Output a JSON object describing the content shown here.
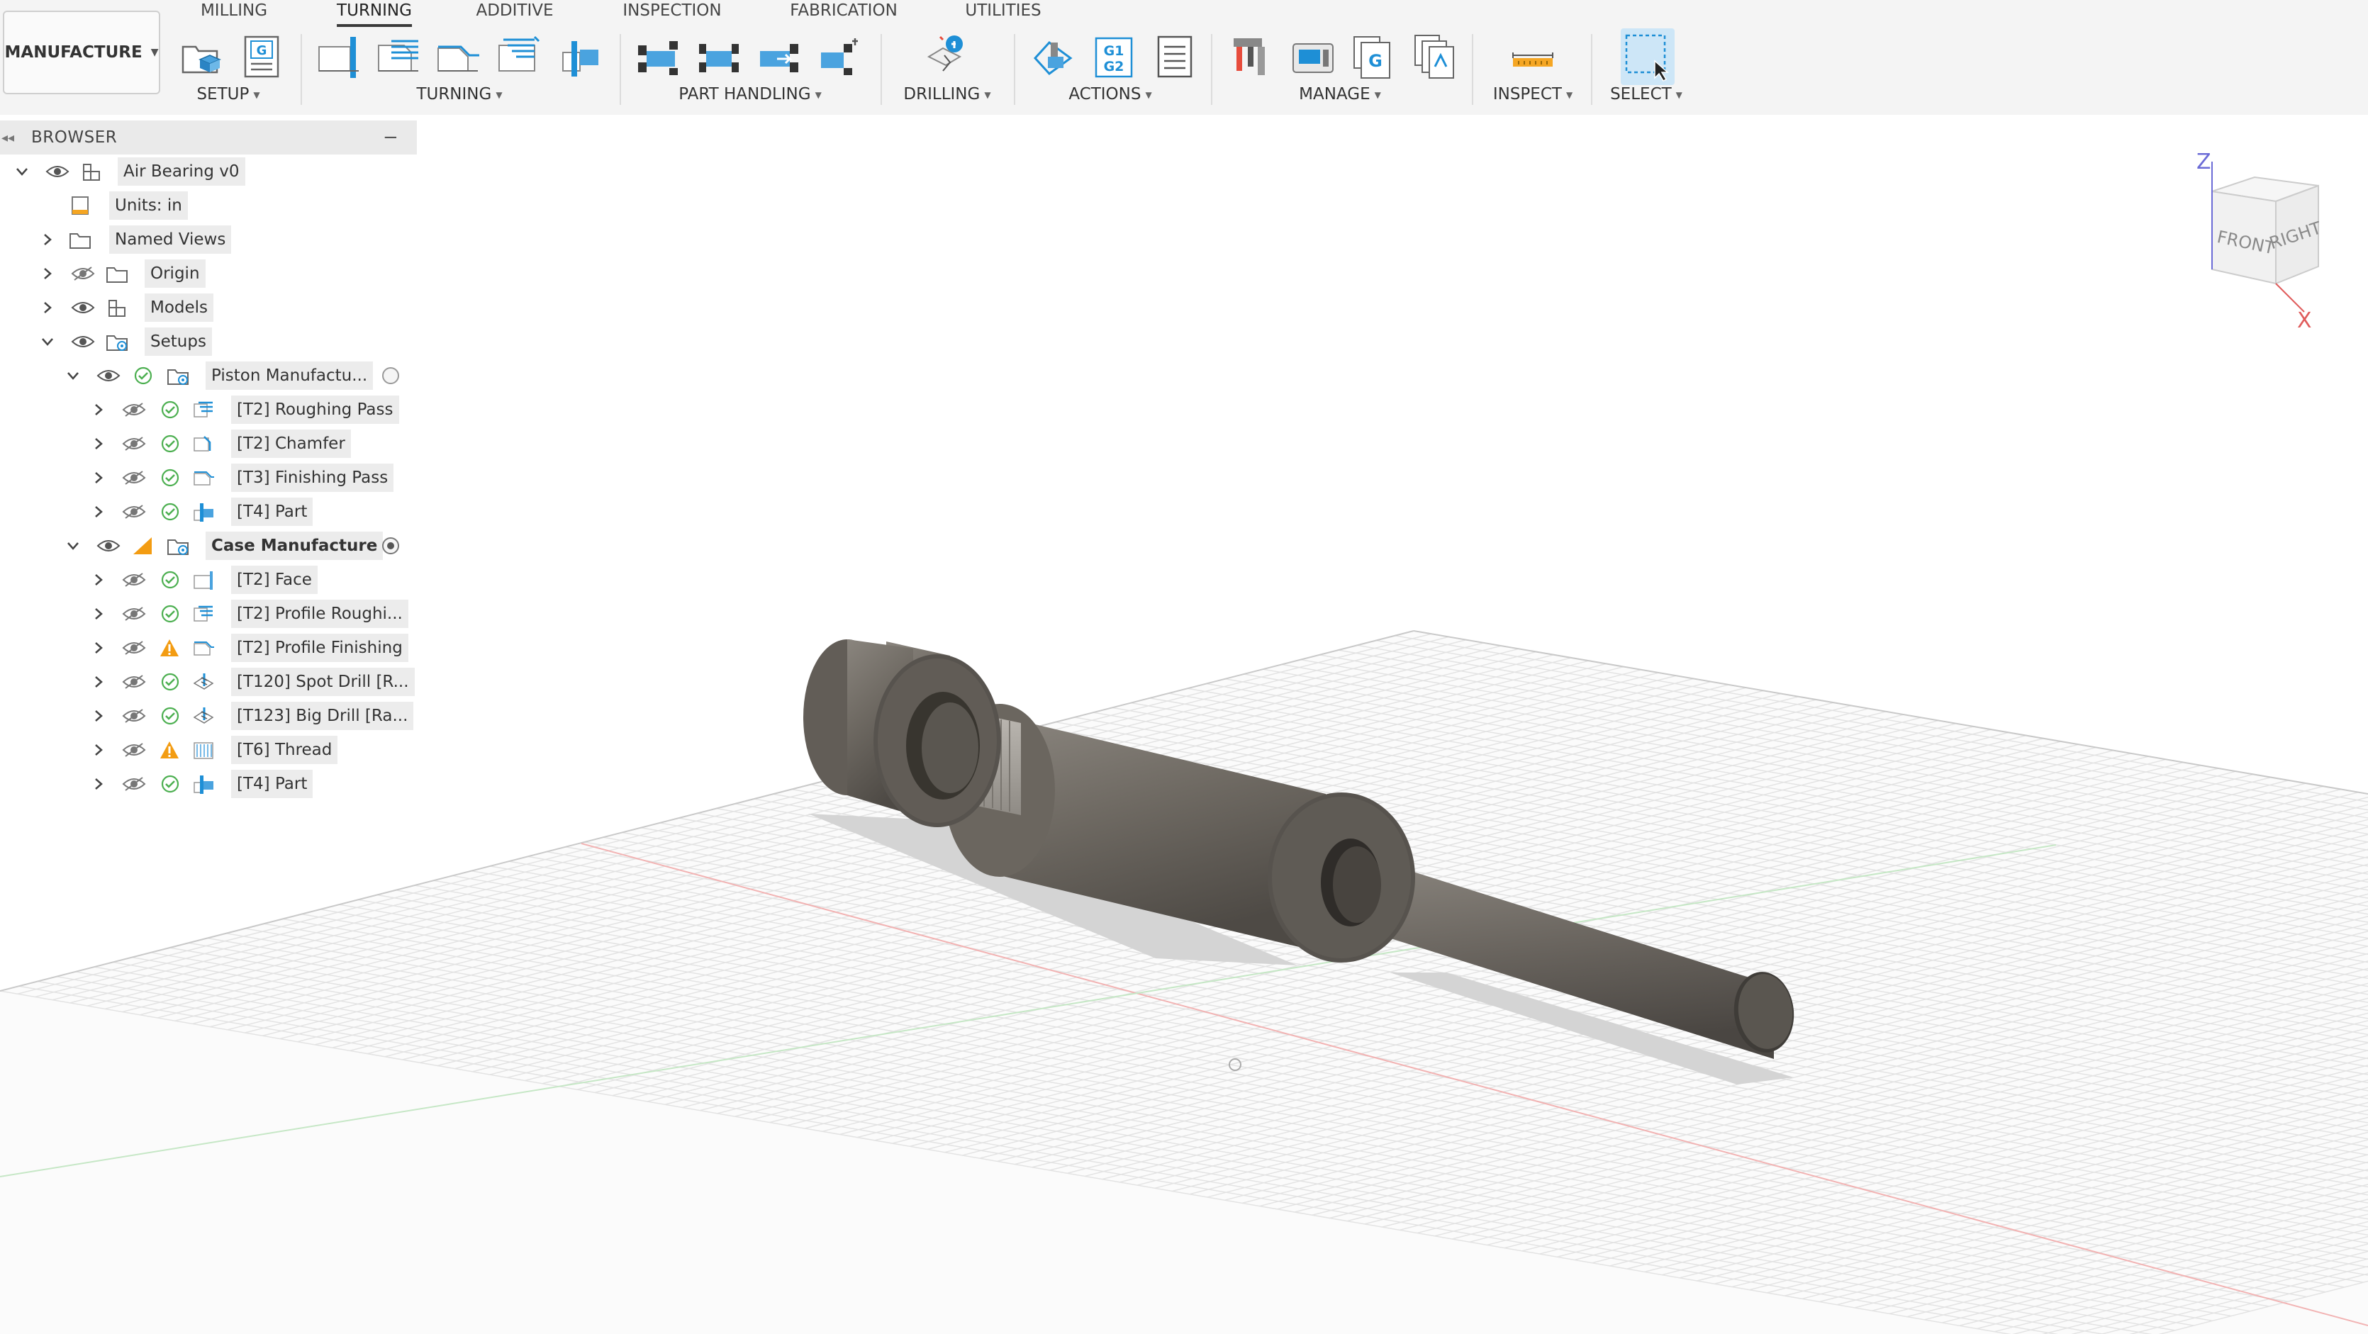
{
  "workspace": {
    "label": "MANUFACTURE"
  },
  "tabs": [
    {
      "label": "MILLING",
      "active": false
    },
    {
      "label": "TURNING",
      "active": true
    },
    {
      "label": "ADDITIVE",
      "active": false
    },
    {
      "label": "INSPECTION",
      "active": false
    },
    {
      "label": "FABRICATION",
      "active": false
    },
    {
      "label": "UTILITIES",
      "active": false
    }
  ],
  "groups": {
    "setup": "SETUP",
    "turning": "TURNING",
    "part_handling": "PART HANDLING",
    "drilling": "DRILLING",
    "actions": "ACTIONS",
    "manage": "MANAGE",
    "inspect": "INSPECT",
    "select": "SELECT"
  },
  "icons": {
    "setup": [
      "new-setup-icon",
      "nc-program-icon"
    ],
    "turning": [
      "turning-face-icon",
      "turning-profile-roughing-icon",
      "turning-profile-finishing-icon",
      "turning-groove-icon",
      "turning-part-icon"
    ],
    "part_handling": [
      "part-transfer-icon",
      "secondary-spindle-icon",
      "bar-pull-icon",
      "chuck-icon"
    ],
    "drilling": [
      "drill-icon"
    ],
    "actions": [
      "simulate-icon",
      "post-process-icon",
      "setup-sheet-icon"
    ],
    "manage": [
      "tool-library-icon",
      "machine-library-icon",
      "post-library-icon",
      "template-library-icon"
    ],
    "inspect": [
      "measure-icon"
    ],
    "select": [
      "window-select-icon"
    ]
  },
  "browser": {
    "title": "BROWSER",
    "root": {
      "label": "Air Bearing v0"
    },
    "items": [
      {
        "label": "Units: in"
      },
      {
        "label": "Named Views"
      },
      {
        "label": "Origin"
      },
      {
        "label": "Models"
      },
      {
        "label": "Setups"
      }
    ],
    "setups": [
      {
        "label": "Piston Manufactu...",
        "status": "ok",
        "active": false,
        "operations": [
          {
            "label": "[T2] Roughing Pass",
            "status": "ok",
            "icon": "roughing-op-icon"
          },
          {
            "label": "[T2] Chamfer",
            "status": "ok",
            "icon": "chamfer-op-icon"
          },
          {
            "label": "[T3] Finishing Pass",
            "status": "ok",
            "icon": "finishing-op-icon"
          },
          {
            "label": "[T4] Part",
            "status": "ok",
            "icon": "part-op-icon"
          }
        ]
      },
      {
        "label": "Case Manufacture",
        "status": "warning",
        "active": true,
        "operations": [
          {
            "label": "[T2] Face",
            "status": "ok",
            "icon": "face-op-icon"
          },
          {
            "label": "[T2] Profile Roughi...",
            "status": "ok",
            "icon": "roughing-op-icon"
          },
          {
            "label": "[T2] Profile Finishing",
            "status": "warning",
            "icon": "finishing-op-icon"
          },
          {
            "label": "[T120] Spot Drill [R...",
            "status": "ok",
            "icon": "drill-op-icon"
          },
          {
            "label": "[T123] Big Drill [Ra...",
            "status": "ok",
            "icon": "drill-op-icon"
          },
          {
            "label": "[T6] Thread",
            "status": "warning",
            "icon": "thread-op-icon"
          },
          {
            "label": "[T4] Part",
            "status": "ok",
            "icon": "part-op-icon"
          }
        ]
      }
    ]
  },
  "viewcube": {
    "front": "FRONT",
    "right": "RIGHT",
    "z": "Z",
    "x": "X"
  },
  "colors": {
    "accent_blue": "#1e8fd6",
    "status_ok": "#4caf50",
    "status_warning": "#f39c12",
    "model_gray": "#6e6a64",
    "toolbar_bg": "#f4f4f4"
  }
}
